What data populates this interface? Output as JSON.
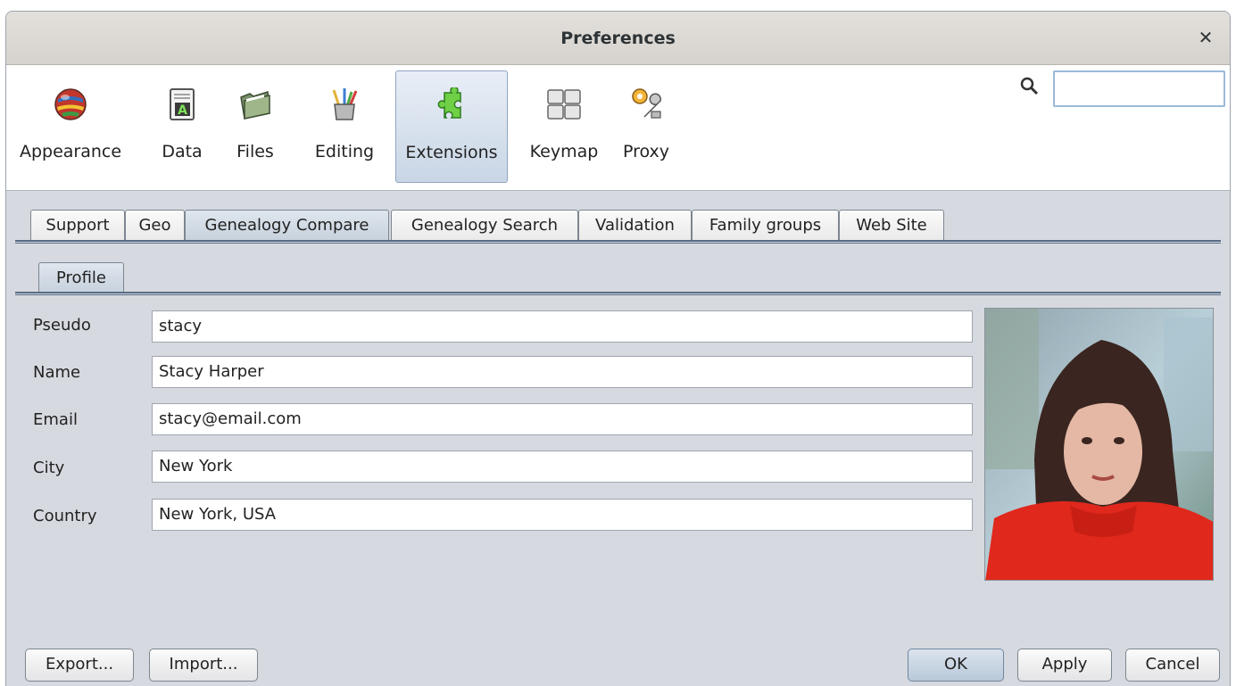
{
  "window": {
    "title": "Preferences"
  },
  "toolbar": {
    "items": [
      {
        "label": "Appearance",
        "icon": "globe-icon"
      },
      {
        "label": "Data",
        "icon": "document-icon"
      },
      {
        "label": "Files",
        "icon": "folder-icon"
      },
      {
        "label": "Editing",
        "icon": "pencil-cup-icon"
      },
      {
        "label": "Extensions",
        "icon": "puzzle-icon",
        "active": true
      },
      {
        "label": "Keymap",
        "icon": "keyboard-icon"
      },
      {
        "label": "Proxy",
        "icon": "gear-wrench-icon"
      }
    ],
    "search_value": ""
  },
  "tabs": [
    {
      "label": "Support"
    },
    {
      "label": "Geo"
    },
    {
      "label": "Genealogy Compare",
      "selected": true
    },
    {
      "label": "Genealogy Search"
    },
    {
      "label": "Validation"
    },
    {
      "label": "Family groups"
    },
    {
      "label": "Web Site"
    }
  ],
  "subtabs": [
    {
      "label": "Profile",
      "selected": true
    }
  ],
  "profile": {
    "fields": [
      {
        "label": "Pseudo",
        "value": "stacy"
      },
      {
        "label": "Name",
        "value": "Stacy Harper"
      },
      {
        "label": "Email",
        "value": "stacy@email.com"
      },
      {
        "label": "City",
        "value": "New York"
      },
      {
        "label": "Country",
        "value": "New York, USA"
      }
    ]
  },
  "buttons": {
    "export": "Export...",
    "import": "Import...",
    "ok": "OK",
    "apply": "Apply",
    "cancel": "Cancel"
  },
  "colors": {
    "accent": "#566c85",
    "active_tool": "#c9d6e6",
    "photo_dress": "#e0281c"
  }
}
